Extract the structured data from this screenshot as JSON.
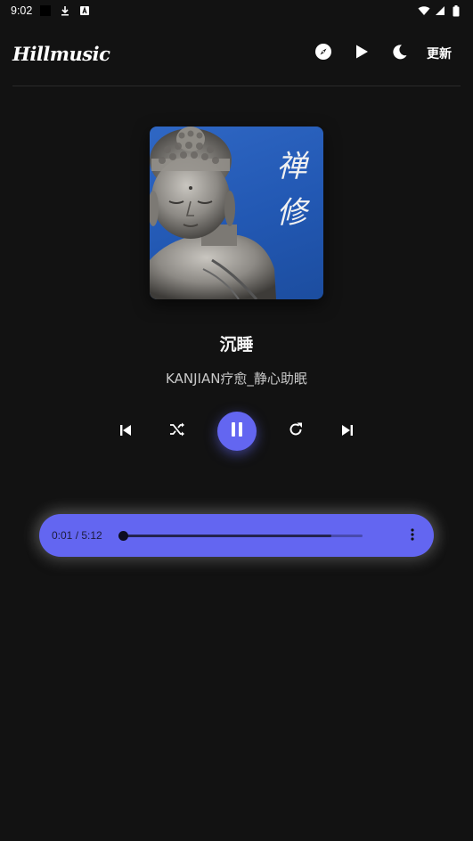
{
  "status_bar": {
    "time": "9:02",
    "icons": [
      "square-notification-icon",
      "download-icon",
      "font-icon",
      "wifi-icon",
      "signal-icon",
      "battery-icon"
    ]
  },
  "header": {
    "logo": "Hillmusic",
    "actions": [
      "compass-icon",
      "play-icon",
      "moon-icon"
    ],
    "update_label": "更新"
  },
  "track": {
    "title": "沉睡",
    "artist": "KANJIAN疗愈_静心助眠",
    "cover_text": "禅修"
  },
  "controls": [
    "skip-previous-icon",
    "shuffle-icon",
    "pause-icon",
    "repeat-icon",
    "skip-next-icon"
  ],
  "player": {
    "time": "0:01 / 5:12",
    "current_seconds": 1,
    "duration_seconds": 312,
    "played_fraction": 0.87
  },
  "colors": {
    "background": "#121212",
    "accent": "#6366f1",
    "cover_blue": "#2258b3"
  }
}
